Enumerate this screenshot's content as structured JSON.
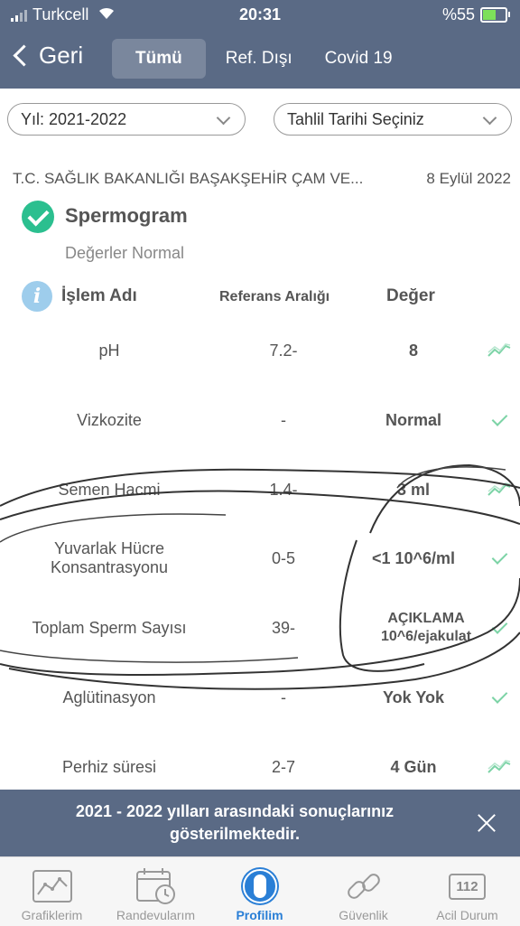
{
  "status_bar": {
    "carrier": "Turkcell",
    "time": "20:31",
    "battery": "%55",
    "battery_level": 0.55
  },
  "nav": {
    "back_label": "Geri",
    "tabs": [
      {
        "label": "Tümü",
        "active": true
      },
      {
        "label": "Ref. Dışı",
        "active": false
      },
      {
        "label": "Covid 19",
        "active": false
      }
    ]
  },
  "filters": {
    "year": "Yıl: 2021-2022",
    "date": "Tahlil Tarihi Seçiniz"
  },
  "record": {
    "hospital": "T.C. SAĞLIK BAKANLIĞI BAŞAKŞEHİR ÇAM VE...",
    "date": "8 Eylül 2022",
    "title": "Spermogram",
    "status": "Değerler Normal"
  },
  "table": {
    "headers": {
      "name": "İşlem Adı",
      "range": "Referans Aralığı",
      "value": "Değer"
    },
    "rows": [
      {
        "name": "pH",
        "range": "7.2-",
        "value": "8",
        "icon": "trend-chart-icon"
      },
      {
        "name": "Vizkozite",
        "range": "-",
        "value": "Normal",
        "icon": "check-icon"
      },
      {
        "name": "Semen Hacmi",
        "range": "1.4-",
        "value": "3 ml",
        "icon": "trend-chart-icon"
      },
      {
        "name": "Yuvarlak Hücre Konsantrasyonu",
        "range": "0-5",
        "value": "<1 10^6/ml",
        "icon": "check-icon"
      },
      {
        "name": "Toplam Sperm Sayısı",
        "range": "39-",
        "value": "AÇIKLAMA 10^6/ejakulat",
        "icon": "check-icon"
      },
      {
        "name": "Aglütinasyon",
        "range": "-",
        "value": "Yok Yok",
        "icon": "check-icon"
      },
      {
        "name": "Perhiz süresi",
        "range": "2-7",
        "value": "4 Gün",
        "icon": "trend-chart-icon"
      }
    ]
  },
  "banner": {
    "text": "2021 - 2022 yılları arasındaki sonuçlarınız gösterilmektedir."
  },
  "bottom_nav": [
    {
      "label": "Grafiklerim",
      "icon": "chart-icon",
      "active": false
    },
    {
      "label": "Randevularım",
      "icon": "calendar-icon",
      "active": false
    },
    {
      "label": "Profilim",
      "icon": "profile-icon",
      "active": true
    },
    {
      "label": "Güvenlik",
      "icon": "link-icon",
      "active": false
    },
    {
      "label": "Acil Durum",
      "icon": "emergency-112-icon",
      "active": false
    }
  ],
  "emergency_number": "112",
  "colors": {
    "header": "#5a6a85",
    "accent_green": "#2bbf8f",
    "active_blue": "#2a7fd6"
  }
}
